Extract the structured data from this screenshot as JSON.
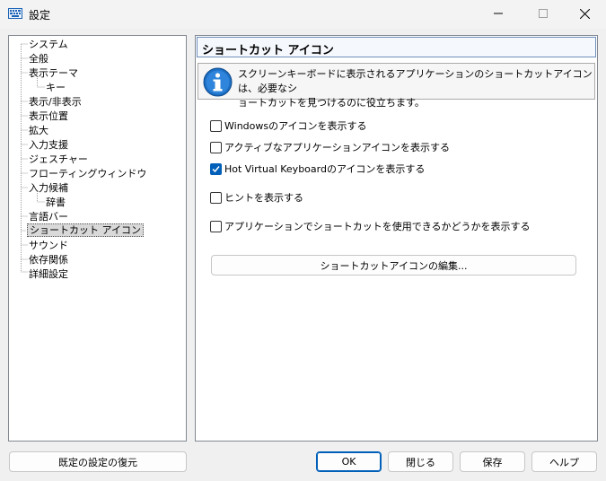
{
  "window": {
    "title": "設定"
  },
  "tree": {
    "items": [
      {
        "label": "システム",
        "level": 0
      },
      {
        "label": "全般",
        "level": 0
      },
      {
        "label": "表示テーマ",
        "level": 0
      },
      {
        "label": "キー",
        "level": 1
      },
      {
        "label": "表示/非表示",
        "level": 0
      },
      {
        "label": "表示位置",
        "level": 0
      },
      {
        "label": "拡大",
        "level": 0
      },
      {
        "label": "入力支援",
        "level": 0
      },
      {
        "label": "ジェスチャー",
        "level": 0
      },
      {
        "label": "フローティングウィンドウ",
        "level": 0
      },
      {
        "label": "入力候補",
        "level": 0
      },
      {
        "label": "辞書",
        "level": 1
      },
      {
        "label": "言語バー",
        "level": 0
      },
      {
        "label": "ショートカット アイコン",
        "level": 0,
        "selected": true
      },
      {
        "label": "サウンド",
        "level": 0
      },
      {
        "label": "依存関係",
        "level": 0
      },
      {
        "label": "詳細設定",
        "level": 0
      }
    ]
  },
  "content": {
    "title": "ショートカット アイコン",
    "info_line1": "スクリーンキーボードに表示されるアプリケーションのショートカットアイコンは、必要なシ",
    "info_line2": "ョートカットを見つけるのに役立ちます。",
    "options": [
      {
        "label": "Windowsのアイコンを表示する",
        "checked": false
      },
      {
        "label": "アクティブなアプリケーションアイコンを表示する",
        "checked": false
      },
      {
        "label": "Hot Virtual Keyboardのアイコンを表示する",
        "checked": true
      },
      {
        "label": "ヒントを表示する",
        "checked": false
      },
      {
        "label": "アプリケーションでショートカットを使用できるかどうかを表示する",
        "checked": false
      }
    ],
    "edit_button": "ショートカットアイコンの編集..."
  },
  "buttons": {
    "restore": "既定の設定の復元",
    "ok": "OK",
    "close": "閉じる",
    "save": "保存",
    "help": "ヘルプ"
  },
  "colors": {
    "accent": "#005fb8",
    "header_border": "#6f8fbd",
    "info_icon": "#1c6fc4"
  }
}
